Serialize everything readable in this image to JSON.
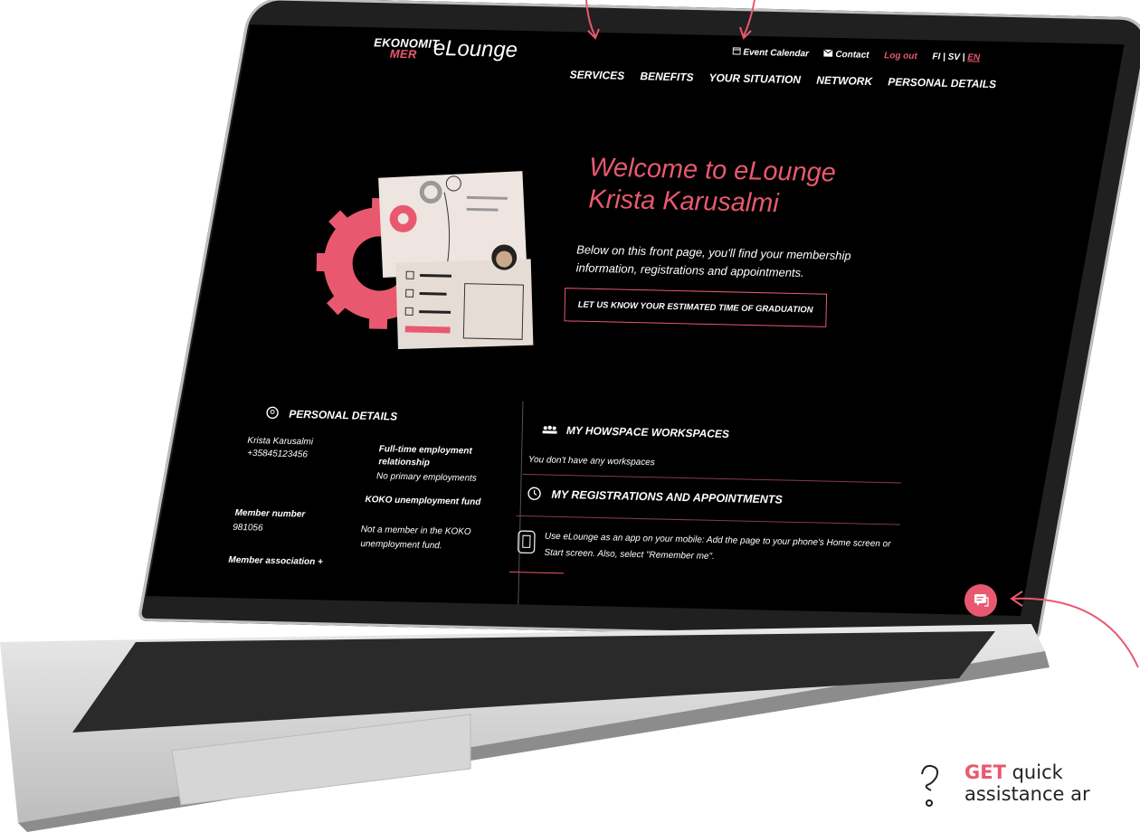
{
  "brand": {
    "logo_line1": "EKONOMIT",
    "logo_line2": "MER",
    "app_name": "eLounge",
    "accent_color": "#e8596f"
  },
  "top_nav": {
    "event_calendar": "Event Calendar",
    "contact": "Contact",
    "logout": "Log out",
    "lang_fi": "FI",
    "lang_sv": "SV",
    "lang_en": "EN",
    "lang_sep": "|"
  },
  "main_nav": [
    "SERVICES",
    "BENEFITS",
    "YOUR SITUATION",
    "NETWORK",
    "PERSONAL DETAILS"
  ],
  "hero": {
    "welcome_line1": "Welcome to eLounge",
    "welcome_line2": "Krista Karusalmi",
    "intro": "Below on this front page, you'll find your membership information, registrations and appointments.",
    "graduation_button": "LET US KNOW YOUR ESTIMATED TIME OF GRADUATION"
  },
  "personal_details": {
    "title": "PERSONAL DETAILS",
    "name": "Krista Karusalmi",
    "phone": "+35845123456",
    "employment_label": "Full-time employment relationship",
    "employment_value": "No primary employments",
    "koko_label": "KOKO unemployment fund",
    "koko_value": "Not a member in the KOKO unemployment fund.",
    "member_number_label": "Member number",
    "member_number_value": "981056",
    "member_association_label": "Member association +"
  },
  "howspace": {
    "title": "MY HOWSPACE WORKSPACES",
    "empty_text": "You don't have any workspaces"
  },
  "registrations": {
    "title": "MY REGISTRATIONS AND APPOINTMENTS",
    "app_tip": "Use eLounge as an app on your mobile: Add the page to your phone's Home screen or Start screen. Also, select \"Remember me\"."
  },
  "promo": {
    "get": "GET",
    "rest_line1": " quick",
    "line2": "assistance ar"
  },
  "icons": {
    "calendar": "calendar-icon",
    "contact": "envelope-icon",
    "person": "person-circle-icon",
    "group": "group-icon",
    "clock": "clock-icon",
    "phone": "phone-icon",
    "chat": "chat-icon",
    "question": "question-icon"
  }
}
